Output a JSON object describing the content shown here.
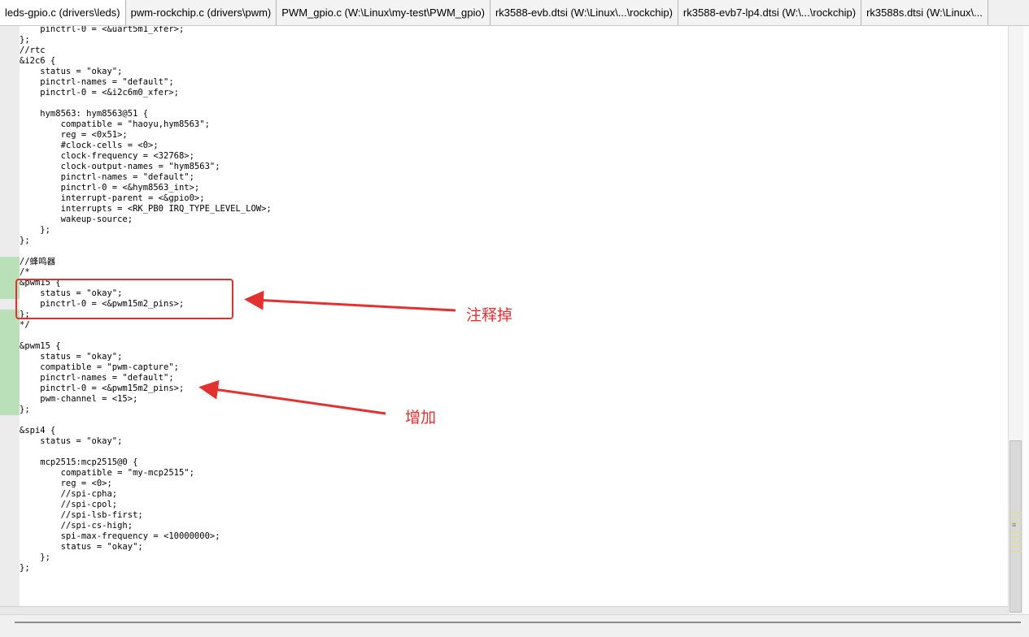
{
  "tabs": [
    {
      "label": "leds-gpio.c (drivers\\leds)"
    },
    {
      "label": "pwm-rockchip.c (drivers\\pwm)"
    },
    {
      "label": "PWM_gpio.c (W:\\Linux\\my-test\\PWM_gpio)"
    },
    {
      "label": "rk3588-evb.dtsi (W:\\Linux\\...\\rockchip)"
    },
    {
      "label": "rk3588-evb7-lp4.dtsi (W:\\...\\rockchip)"
    },
    {
      "label": "rk3588s.dtsi (W:\\Linux\\..."
    }
  ],
  "code_lines": [
    "    pinctrl-0 = <&uart5m1_xfer>;",
    "};",
    "//rtc",
    "&i2c6 {",
    "    status = \"okay\";",
    "    pinctrl-names = \"default\";",
    "    pinctrl-0 = <&i2c6m0_xfer>;",
    "",
    "    hym8563: hym8563@51 {",
    "        compatible = \"haoyu,hym8563\";",
    "        reg = <0x51>;",
    "        #clock-cells = <0>;",
    "        clock-frequency = <32768>;",
    "        clock-output-names = \"hym8563\";",
    "        pinctrl-names = \"default\";",
    "        pinctrl-0 = <&hym8563_int>;",
    "        interrupt-parent = <&gpio0>;",
    "        interrupts = <RK_PB0 IRQ_TYPE_LEVEL_LOW>;",
    "        wakeup-source;",
    "    };",
    "};",
    "",
    "//蜂鸣器",
    "/*",
    "&pwm15 {",
    "    status = \"okay\";",
    "    pinctrl-0 = <&pwm15m2_pins>;",
    "};",
    "*/",
    "",
    "&pwm15 {",
    "    status = \"okay\";",
    "    compatible = \"pwm-capture\";",
    "    pinctrl-names = \"default\";",
    "    pinctrl-0 = <&pwm15m2_pins>;",
    "    pwm-channel = <15>;",
    "};",
    "",
    "&spi4 {",
    "    status = \"okay\";",
    "",
    "    mcp2515:mcp2515@0 {",
    "        compatible = \"my-mcp2515\";",
    "        reg = <0>;",
    "        //spi-cpha;",
    "        //spi-cpol;",
    "        //spi-lsb-first;",
    "        //spi-cs-high;",
    "        spi-max-frequency = <10000000>;",
    "        status = \"okay\";",
    "    };",
    "};"
  ],
  "changed_lines": [
    [
      22,
      24
    ],
    [
      27,
      36
    ]
  ],
  "annotations": {
    "comment_out": "注释掉",
    "added": "增加",
    "color": "#e53030"
  },
  "scrollbar": {
    "marker": "≡"
  },
  "colors": {
    "change_bar": "#b9e0b9",
    "annotation": "#e53030"
  }
}
